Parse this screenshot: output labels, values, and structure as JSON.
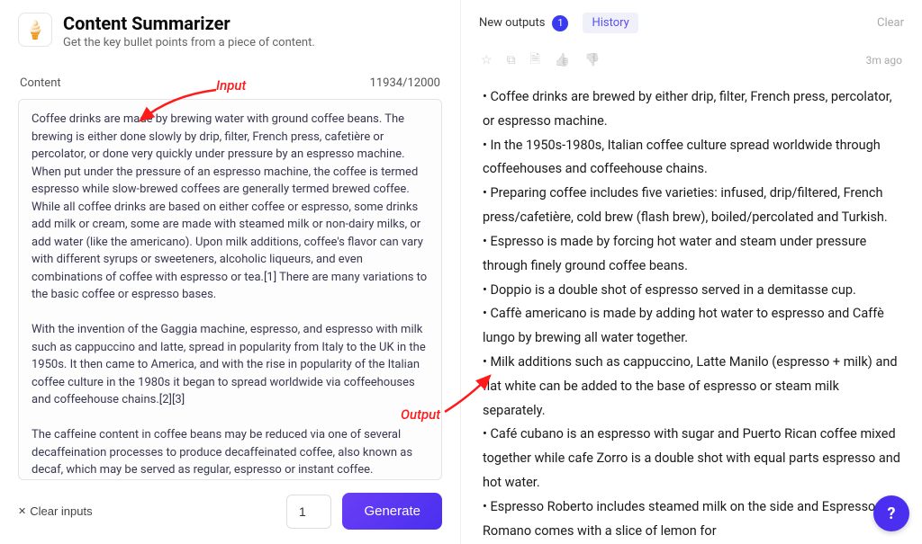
{
  "header": {
    "icon_glyph": "🍦",
    "title": "Content Summarizer",
    "subtitle": "Get the key bullet points from a piece of content."
  },
  "content": {
    "label": "Content",
    "counter": "11934/12000",
    "text": "Coffee drinks are made by brewing water with ground coffee beans. The brewing is either done slowly by drip, filter, French press, cafetière or percolator, or done very quickly under pressure by an espresso machine. When put under the pressure of an espresso machine, the coffee is termed espresso while slow-brewed coffees are generally termed brewed coffee. While all coffee drinks are based on either coffee or espresso, some drinks add milk or cream, some are made with steamed milk or non-dairy milks, or add water (like the americano). Upon milk additions, coffee's flavor can vary with different syrups or sweeteners, alcoholic liqueurs, and even combinations of coffee with espresso or tea.[1] There are many variations to the basic coffee or espresso bases.\n\nWith the invention of the Gaggia machine, espresso, and espresso with milk such as cappuccino and latte, spread in popularity from Italy to the UK in the 1950s. It then came to America, and with the rise in popularity of the Italian coffee culture in the 1980s it began to spread worldwide via coffeehouses and coffeehouse chains.[2][3]\n\nThe caffeine content in coffee beans may be reduced via one of several decaffeination processes to produce decaffeinated coffee, also known as decaf, which may be served as regular, espresso or instant coffee."
  },
  "footer": {
    "clear_label": "Clear inputs",
    "count_value": "1",
    "generate_label": "Generate"
  },
  "tabs": {
    "new_label": "New outputs",
    "badge": "1",
    "history_label": "History",
    "clear_label": "Clear"
  },
  "icons": {
    "star": "☆",
    "copy": "⧉",
    "doc": "🗎",
    "thumbs_up": "👍",
    "thumbs_down": "👎",
    "timestamp": "3m ago"
  },
  "output": {
    "text": "• Coffee drinks are brewed by either drip, filter, French press, percolator, or espresso machine.\n• In the 1950s-1980s, Italian coffee culture spread worldwide through coffeehouses and coffeehouse chains.\n• Preparing coffee includes five varieties: infused, drip/filtered, French press/cafetière, cold brew (flash brew), boiled/percolated and Turkish.\n• Espresso is made by forcing hot water and steam under pressure through finely ground coffee beans.\n• Doppio is a double shot of espresso served in a demitasse cup.\n• Caffè americano is made by adding hot water to espresso and Caffè lungo by brewing all water together.\n• Milk additions such as cappuccino, Latte Manilo (espresso + milk) and flat white can be added to the base of espresso or steam milk separately.\n• Café cubano is an espresso with sugar and Puerto Rican coffee mixed together while cafe Zorro is a double shot with equal parts espresso and hot water.\n• Espresso Roberto includes steamed milk on the side and Espresso Romano comes with a slice of lemon for"
  },
  "annotations": {
    "input_label": "Input",
    "output_label": "Output"
  },
  "help": {
    "label": "?"
  }
}
